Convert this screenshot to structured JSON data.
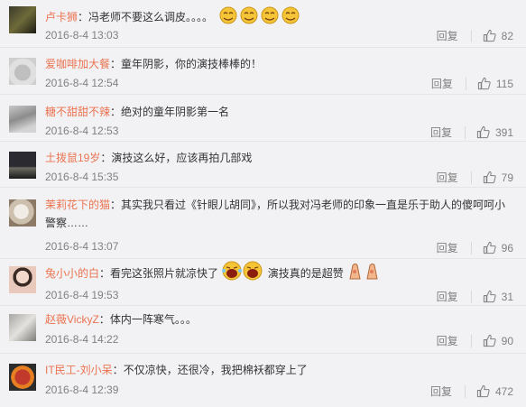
{
  "actions": {
    "reply_label": "回复"
  },
  "comments": [
    {
      "name": "卢卡狮",
      "text": "冯老师不要这么调皮。。。。",
      "time": "2016-8-4 13:03",
      "likes": "82"
    },
    {
      "name": "爱咖啡加大餐",
      "text": "童年阴影，你的演技棒棒的！",
      "time": "2016-8-4 12:54",
      "likes": "115"
    },
    {
      "name": "糖不甜甜不辣",
      "text": "绝对的童年阴影第一名",
      "time": "2016-8-4 12:53",
      "likes": "391"
    },
    {
      "name": "土拨鼠19岁",
      "text": "演技这么好，应该再拍几部戏",
      "time": "2016-8-4 15:35",
      "likes": "79"
    },
    {
      "name": "茉莉花下的猫",
      "text": "其实我只看过《针眼儿胡同》，所以我对冯老师的印象一直是乐于助人的傻呵呵小警察……",
      "time": "2016-8-4 13:07",
      "likes": "96"
    },
    {
      "name": "兔小小的白",
      "text": "看完这张照片就凉快了",
      "text2": "演技真的是超赞",
      "time": "2016-8-4 19:53",
      "likes": "31"
    },
    {
      "name": "赵薇VickyZ",
      "text": "体内一阵寒气。。。",
      "time": "2016-8-4 14:22",
      "likes": "90"
    },
    {
      "name": "IT民工-刘小呆",
      "text": "不仅凉快，还很冷，我把棉袄都穿上了",
      "time": "2016-8-4 12:39",
      "likes": "472"
    }
  ]
}
